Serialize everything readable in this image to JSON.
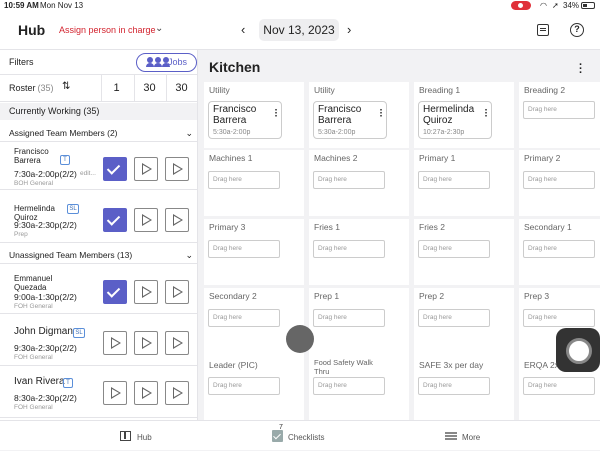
{
  "status_bar": {
    "time": "10:59 AM",
    "date": "Mon Nov 13",
    "battery": "34%"
  },
  "header": {
    "title": "Hub",
    "assign_label": "Assign person in charge",
    "date": "Nov 13, 2023"
  },
  "filters": {
    "label": "Filters",
    "jobs_label": "Jobs"
  },
  "roster": {
    "label": "Roster",
    "count": "(35)",
    "cells": [
      "1",
      "30",
      "30"
    ]
  },
  "currently_working": "Currently Working (35)",
  "assigned_header": "Assigned Team Members (2)",
  "unassigned_header": "Unassigned Team Members (13)",
  "assigned_members": [
    {
      "name": "Francisco Barrera",
      "badge": "T",
      "time": "7:30a-2:00p(2/2)",
      "edit": "edit...",
      "role": "BOH General"
    },
    {
      "name": "Hermelinda Quiroz",
      "badge": "SL",
      "time": "9:30a-2:30p(2/2)",
      "role": "Prep"
    }
  ],
  "unassigned_members": [
    {
      "name": "Emmanuel Quezada",
      "time": "9:00a-1:30p(2/2)",
      "role": "FOH General"
    },
    {
      "name": "John Digman",
      "badge": "SL",
      "time": "9:30a-2:30p(2/2)",
      "role": "FOH General"
    },
    {
      "name": "Ivan Rivera",
      "badge": "T",
      "time": "8:30a-2:30p(2/2)",
      "role": "FOH General"
    }
  ],
  "main": {
    "title": "Kitchen",
    "drag_text": "Drag here"
  },
  "stations": [
    {
      "label": "Utility",
      "assigned": {
        "name": "Francisco Barrera",
        "time": "5:30a-2:00p"
      }
    },
    {
      "label": "Utility",
      "assigned": {
        "name": "Francisco Barrera",
        "time": "5:30a-2:00p"
      }
    },
    {
      "label": "Breading 1",
      "assigned": {
        "name": "Hermelinda Quiroz",
        "time": "10:27a-2:30p"
      }
    },
    {
      "label": "Breading 2"
    },
    {
      "label": "Machines 1"
    },
    {
      "label": "Machines 2"
    },
    {
      "label": "Primary 1"
    },
    {
      "label": "Primary 2"
    },
    {
      "label": "Primary 3"
    },
    {
      "label": "Fries 1"
    },
    {
      "label": "Fries 2"
    },
    {
      "label": "Secondary 1"
    },
    {
      "label": "Secondary 2"
    },
    {
      "label": "Prep 1"
    },
    {
      "label": "Prep 2"
    },
    {
      "label": "Prep 3"
    },
    {
      "label": "Leader (PIC)"
    },
    {
      "label": "Food Safety Walk Thru"
    },
    {
      "label": "SAFE 3x per day"
    },
    {
      "label": "ERQA 2x"
    }
  ],
  "bottom_nav": {
    "hub": "Hub",
    "checklists": "Checklists",
    "checklist_count": "7",
    "more": "More"
  }
}
